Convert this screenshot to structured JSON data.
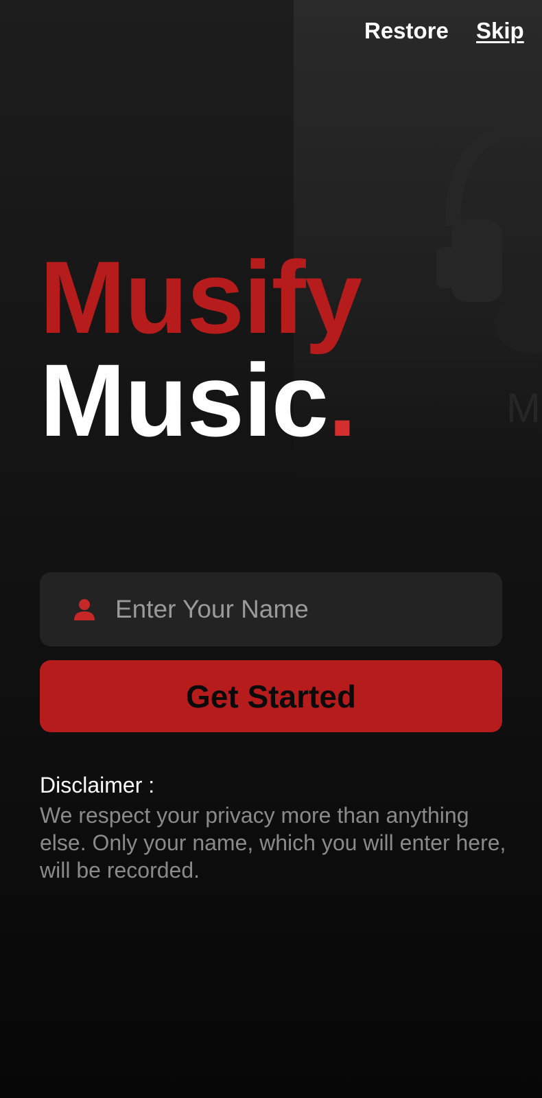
{
  "header": {
    "restore_label": "Restore",
    "skip_label": "Skip"
  },
  "brand": {
    "line1": "Musify",
    "line2": "Music",
    "dot": "."
  },
  "form": {
    "name_placeholder": "Enter Your Name",
    "name_value": "",
    "user_icon": "user-icon",
    "submit_label": "Get Started"
  },
  "disclaimer": {
    "title": "Disclaimer :",
    "text": "We respect your privacy more than anything else. Only your name, which you will enter here, will be recorded."
  },
  "background": {
    "art_icon": "headphones-icon",
    "partial_letter": "M"
  },
  "colors": {
    "accent": "#b71c1c",
    "background": "#141414",
    "field": "#232323",
    "text_primary": "#ffffff",
    "text_muted": "#8a8a8a"
  }
}
